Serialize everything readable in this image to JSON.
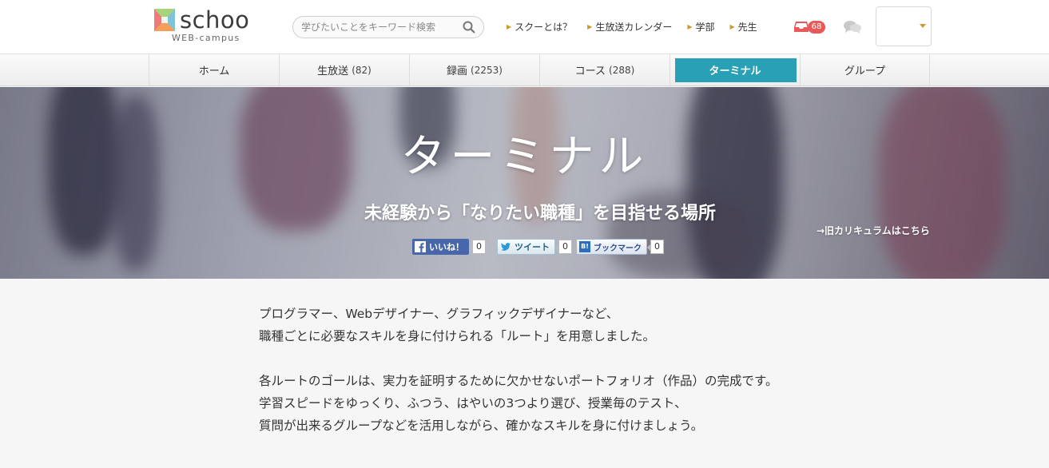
{
  "logo": {
    "word": "schoo",
    "sub": "WEB-campus"
  },
  "search": {
    "placeholder": "学びたいことをキーワード検索"
  },
  "topnav": [
    {
      "label": "スクーとは？"
    },
    {
      "label": "生放送カレンダー"
    },
    {
      "label": "学部"
    },
    {
      "label": "先生"
    }
  ],
  "notifications": {
    "count": "68"
  },
  "tabs": [
    {
      "label": "ホーム",
      "count": ""
    },
    {
      "label": "生放送",
      "count": "(82)"
    },
    {
      "label": "録画",
      "count": "(2253)"
    },
    {
      "label": "コース",
      "count": "(288)"
    },
    {
      "label": "ターミナル",
      "count": ""
    },
    {
      "label": "グループ",
      "count": ""
    }
  ],
  "hero": {
    "title": "ターミナル",
    "subtitle": "未経験から「なりたい職種」を目指せる場所",
    "old_link": "→旧カリキュラムはこちら"
  },
  "social": {
    "facebook": {
      "label": "いいね！",
      "count": "0"
    },
    "twitter": {
      "label": "ツイート",
      "count": "0"
    },
    "hatena": {
      "label": "ブックマーク",
      "icon_text": "B!",
      "count": "0"
    }
  },
  "intro": {
    "para1": [
      "プログラマー、Webデザイナー、グラフィックデザイナーなど、",
      "職種ごとに必要なスキルを身に付けられる「ルート」を用意しました。"
    ],
    "para2": [
      "各ルートのゴールは、実力を証明するために欠かせないポートフォリオ（作品）の完成です。",
      "学習スピードをゆっくり、ふつう、はやいの3つより選び、授業毎のテスト、",
      "質問が出来るグループなどを活用しながら、確かなスキルを身に付けましょう。"
    ]
  },
  "colors": {
    "accent": "#2aa0b7",
    "badge": "#e85a5a",
    "nav_marker": "#c99a2e",
    "facebook": "#4867aa"
  }
}
